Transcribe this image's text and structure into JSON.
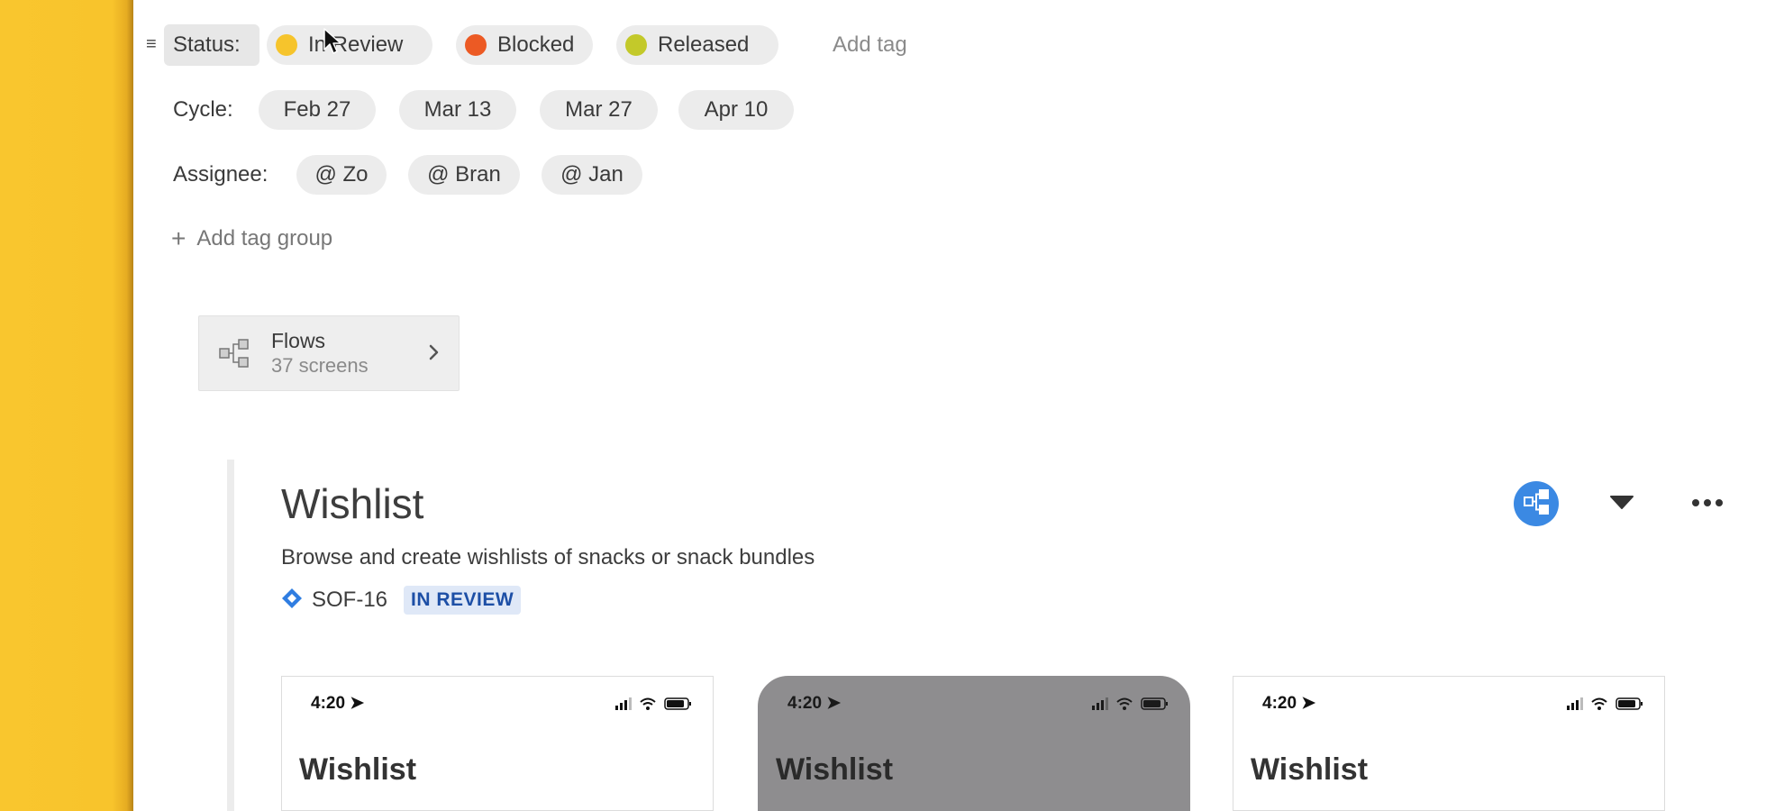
{
  "tag_groups": {
    "status": {
      "label": "Status:",
      "tags": [
        {
          "label": "In Review",
          "color": "#f6c42c"
        },
        {
          "label": "Blocked",
          "color": "#ec5a24"
        },
        {
          "label": "Released",
          "color": "#c3c92a"
        }
      ],
      "add_tag_label": "Add tag"
    },
    "cycle": {
      "label": "Cycle:",
      "tags": [
        "Feb 27",
        "Mar 13",
        "Mar 27",
        "Apr 10"
      ]
    },
    "assignee": {
      "label": "Assignee:",
      "tags": [
        "@ Zo",
        "@ Bran",
        "@ Jan"
      ]
    },
    "add_group_label": "Add tag group"
  },
  "flows_card": {
    "title": "Flows",
    "subtitle": "37 screens",
    "icon": "flow-diagram-icon"
  },
  "flow": {
    "title": "Wishlist",
    "description": "Browse and create wishlists of snacks or snack bundles",
    "jira_key": "SOF-16",
    "status": "IN REVIEW",
    "accent_color": "#3b89e3"
  },
  "screens": [
    {
      "time": "4:20",
      "title": "Wishlist"
    },
    {
      "time": "4:20",
      "title": "Wishlist"
    },
    {
      "time": "4:20",
      "title": "Wishlist"
    }
  ]
}
